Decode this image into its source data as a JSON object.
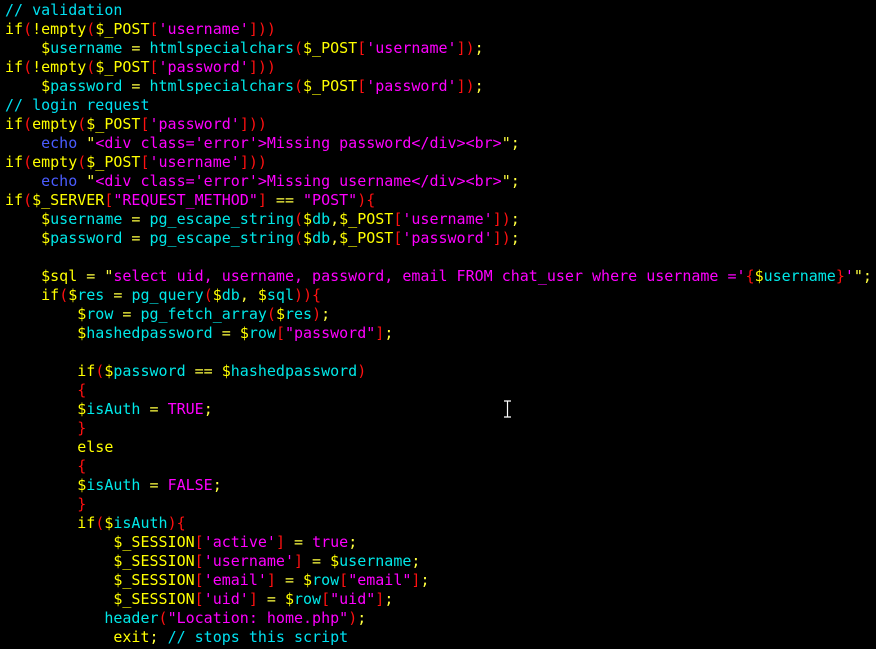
{
  "editor": {
    "colors": {
      "keyword": "#ffff00",
      "identifier": "#00e8e8",
      "string": "#ff00ff",
      "bracket": "#ff1010",
      "comment": "#00e0f0",
      "echo": "#4a5cff",
      "background": "#000000"
    },
    "lines": [
      [
        [
          "c",
          "// validation"
        ]
      ],
      [
        [
          "k",
          "if"
        ],
        [
          "p",
          "("
        ],
        [
          "k",
          "!empty"
        ],
        [
          "p",
          "("
        ],
        [
          "v",
          "$_POST"
        ],
        [
          "p",
          "["
        ],
        [
          "s",
          "'username'"
        ],
        [
          "p",
          "]))"
        ]
      ],
      [
        [
          "sp",
          "    "
        ],
        [
          "v",
          "$"
        ],
        [
          "i",
          "username"
        ],
        [
          "o",
          " = "
        ],
        [
          "i",
          "htmlspecialchars"
        ],
        [
          "p",
          "("
        ],
        [
          "v",
          "$_POST"
        ],
        [
          "p",
          "["
        ],
        [
          "s",
          "'username'"
        ],
        [
          "p",
          "])"
        ],
        [
          "o",
          ";"
        ]
      ],
      [
        [
          "k",
          "if"
        ],
        [
          "p",
          "("
        ],
        [
          "k",
          "!empty"
        ],
        [
          "p",
          "("
        ],
        [
          "v",
          "$_POST"
        ],
        [
          "p",
          "["
        ],
        [
          "s",
          "'password'"
        ],
        [
          "p",
          "]))"
        ]
      ],
      [
        [
          "sp",
          "    "
        ],
        [
          "v",
          "$"
        ],
        [
          "i",
          "password"
        ],
        [
          "o",
          " = "
        ],
        [
          "i",
          "htmlspecialchars"
        ],
        [
          "p",
          "("
        ],
        [
          "v",
          "$_POST"
        ],
        [
          "p",
          "["
        ],
        [
          "s",
          "'password'"
        ],
        [
          "p",
          "])"
        ],
        [
          "o",
          ";"
        ]
      ],
      [
        [
          "c",
          "// login request"
        ]
      ],
      [
        [
          "k",
          "if"
        ],
        [
          "p",
          "("
        ],
        [
          "k",
          "empty"
        ],
        [
          "p",
          "("
        ],
        [
          "v",
          "$_POST"
        ],
        [
          "p",
          "["
        ],
        [
          "s",
          "'password'"
        ],
        [
          "p",
          "]))"
        ]
      ],
      [
        [
          "sp",
          "    "
        ],
        [
          "e",
          "echo"
        ],
        [
          "o",
          " \""
        ],
        [
          "s",
          "<div class='error'>Missing password</div><br>"
        ],
        [
          "o",
          "\";"
        ]
      ],
      [
        [
          "k",
          "if"
        ],
        [
          "p",
          "("
        ],
        [
          "k",
          "empty"
        ],
        [
          "p",
          "("
        ],
        [
          "v",
          "$_POST"
        ],
        [
          "p",
          "["
        ],
        [
          "s",
          "'username'"
        ],
        [
          "p",
          "]))"
        ]
      ],
      [
        [
          "sp",
          "    "
        ],
        [
          "e",
          "echo"
        ],
        [
          "o",
          " \""
        ],
        [
          "s",
          "<div class='error'>Missing username</div><br>"
        ],
        [
          "o",
          "\";"
        ]
      ],
      [
        [
          "k",
          "if"
        ],
        [
          "p",
          "("
        ],
        [
          "v",
          "$_SERVER"
        ],
        [
          "p",
          "["
        ],
        [
          "s",
          "\"REQUEST_METHOD\""
        ],
        [
          "p",
          "]"
        ],
        [
          "o",
          " == "
        ],
        [
          "s",
          "\"POST\""
        ],
        [
          "p",
          "){"
        ]
      ],
      [
        [
          "sp",
          "    "
        ],
        [
          "v",
          "$"
        ],
        [
          "i",
          "username"
        ],
        [
          "o",
          " = "
        ],
        [
          "i",
          "pg_escape_string"
        ],
        [
          "p",
          "("
        ],
        [
          "v",
          "$"
        ],
        [
          "i",
          "db"
        ],
        [
          "o",
          ","
        ],
        [
          "v",
          "$_POST"
        ],
        [
          "p",
          "["
        ],
        [
          "s",
          "'username'"
        ],
        [
          "p",
          "])"
        ],
        [
          "o",
          ";"
        ]
      ],
      [
        [
          "sp",
          "    "
        ],
        [
          "v",
          "$"
        ],
        [
          "i",
          "password"
        ],
        [
          "o",
          " = "
        ],
        [
          "i",
          "pg_escape_string"
        ],
        [
          "p",
          "("
        ],
        [
          "v",
          "$"
        ],
        [
          "i",
          "db"
        ],
        [
          "o",
          ","
        ],
        [
          "v",
          "$_POST"
        ],
        [
          "p",
          "["
        ],
        [
          "s",
          "'password'"
        ],
        [
          "p",
          "])"
        ],
        [
          "o",
          ";"
        ]
      ],
      [
        [
          "sp",
          ""
        ]
      ],
      [
        [
          "sp",
          "    "
        ],
        [
          "v",
          "$sql"
        ],
        [
          "o",
          " = \""
        ],
        [
          "s",
          "select uid, username, password, email FROM chat_user where username ='"
        ],
        [
          "p",
          "{"
        ],
        [
          "v",
          "$"
        ],
        [
          "i",
          "username"
        ],
        [
          "p",
          "}"
        ],
        [
          "s",
          "'"
        ],
        [
          "o",
          "\";"
        ]
      ],
      [
        [
          "sp",
          "    "
        ],
        [
          "k",
          "if"
        ],
        [
          "p",
          "("
        ],
        [
          "v",
          "$"
        ],
        [
          "i",
          "res"
        ],
        [
          "o",
          " = "
        ],
        [
          "i",
          "pg_query"
        ],
        [
          "p",
          "("
        ],
        [
          "v",
          "$"
        ],
        [
          "i",
          "db"
        ],
        [
          "o",
          ", "
        ],
        [
          "v",
          "$"
        ],
        [
          "i",
          "sql"
        ],
        [
          "p",
          ")){"
        ]
      ],
      [
        [
          "sp",
          "        "
        ],
        [
          "v",
          "$"
        ],
        [
          "i",
          "row"
        ],
        [
          "o",
          " = "
        ],
        [
          "i",
          "pg_fetch_array"
        ],
        [
          "p",
          "("
        ],
        [
          "v",
          "$"
        ],
        [
          "i",
          "res"
        ],
        [
          "p",
          ")"
        ],
        [
          "o",
          ";"
        ]
      ],
      [
        [
          "sp",
          "        "
        ],
        [
          "v",
          "$"
        ],
        [
          "i",
          "hashedpassword"
        ],
        [
          "o",
          " = "
        ],
        [
          "v",
          "$"
        ],
        [
          "i",
          "row"
        ],
        [
          "p",
          "["
        ],
        [
          "s",
          "\"password\""
        ],
        [
          "p",
          "]"
        ],
        [
          "o",
          ";"
        ]
      ],
      [
        [
          "sp",
          ""
        ]
      ],
      [
        [
          "sp",
          "        "
        ],
        [
          "k",
          "if"
        ],
        [
          "p",
          "("
        ],
        [
          "v",
          "$"
        ],
        [
          "i",
          "password"
        ],
        [
          "o",
          " == "
        ],
        [
          "v",
          "$"
        ],
        [
          "i",
          "hashedpassword"
        ],
        [
          "p",
          ")"
        ]
      ],
      [
        [
          "sp",
          "        "
        ],
        [
          "p",
          "{"
        ]
      ],
      [
        [
          "sp",
          "        "
        ],
        [
          "v",
          "$"
        ],
        [
          "i",
          "isAuth"
        ],
        [
          "o",
          " = "
        ],
        [
          "s",
          "TRUE"
        ],
        [
          "o",
          ";"
        ]
      ],
      [
        [
          "sp",
          "        "
        ],
        [
          "p",
          "}"
        ]
      ],
      [
        [
          "sp",
          "        "
        ],
        [
          "k",
          "else"
        ]
      ],
      [
        [
          "sp",
          "        "
        ],
        [
          "p",
          "{"
        ]
      ],
      [
        [
          "sp",
          "        "
        ],
        [
          "v",
          "$"
        ],
        [
          "i",
          "isAuth"
        ],
        [
          "o",
          " = "
        ],
        [
          "s",
          "FALSE"
        ],
        [
          "o",
          ";"
        ]
      ],
      [
        [
          "sp",
          "        "
        ],
        [
          "p",
          "}"
        ]
      ],
      [
        [
          "sp",
          "        "
        ],
        [
          "k",
          "if"
        ],
        [
          "p",
          "("
        ],
        [
          "v",
          "$"
        ],
        [
          "i",
          "isAuth"
        ],
        [
          "p",
          "){"
        ]
      ],
      [
        [
          "sp",
          "            "
        ],
        [
          "v",
          "$_SESSION"
        ],
        [
          "p",
          "["
        ],
        [
          "s",
          "'active'"
        ],
        [
          "p",
          "]"
        ],
        [
          "o",
          " = "
        ],
        [
          "s",
          "true"
        ],
        [
          "o",
          ";"
        ]
      ],
      [
        [
          "sp",
          "            "
        ],
        [
          "v",
          "$_SESSION"
        ],
        [
          "p",
          "["
        ],
        [
          "s",
          "'username'"
        ],
        [
          "p",
          "]"
        ],
        [
          "o",
          " = "
        ],
        [
          "v",
          "$"
        ],
        [
          "i",
          "username"
        ],
        [
          "o",
          ";"
        ]
      ],
      [
        [
          "sp",
          "            "
        ],
        [
          "v",
          "$_SESSION"
        ],
        [
          "p",
          "["
        ],
        [
          "s",
          "'email'"
        ],
        [
          "p",
          "]"
        ],
        [
          "o",
          " = "
        ],
        [
          "v",
          "$"
        ],
        [
          "i",
          "row"
        ],
        [
          "p",
          "["
        ],
        [
          "s",
          "\"email\""
        ],
        [
          "p",
          "]"
        ],
        [
          "o",
          ";"
        ]
      ],
      [
        [
          "sp",
          "            "
        ],
        [
          "v",
          "$_SESSION"
        ],
        [
          "p",
          "["
        ],
        [
          "s",
          "'uid'"
        ],
        [
          "p",
          "]"
        ],
        [
          "o",
          " = "
        ],
        [
          "v",
          "$"
        ],
        [
          "i",
          "row"
        ],
        [
          "p",
          "["
        ],
        [
          "s",
          "\"uid\""
        ],
        [
          "p",
          "]"
        ],
        [
          "o",
          ";"
        ]
      ],
      [
        [
          "sp",
          "           "
        ],
        [
          "i",
          "header"
        ],
        [
          "p",
          "("
        ],
        [
          "s",
          "\"Location: home.php\""
        ],
        [
          "p",
          ")"
        ],
        [
          "o",
          ";"
        ]
      ],
      [
        [
          "sp",
          "            "
        ],
        [
          "k",
          "exit"
        ],
        [
          "o",
          "; "
        ],
        [
          "c",
          "// stops this script"
        ]
      ]
    ]
  },
  "cursor": {
    "icon": "text-cursor-ibeam-icon"
  }
}
